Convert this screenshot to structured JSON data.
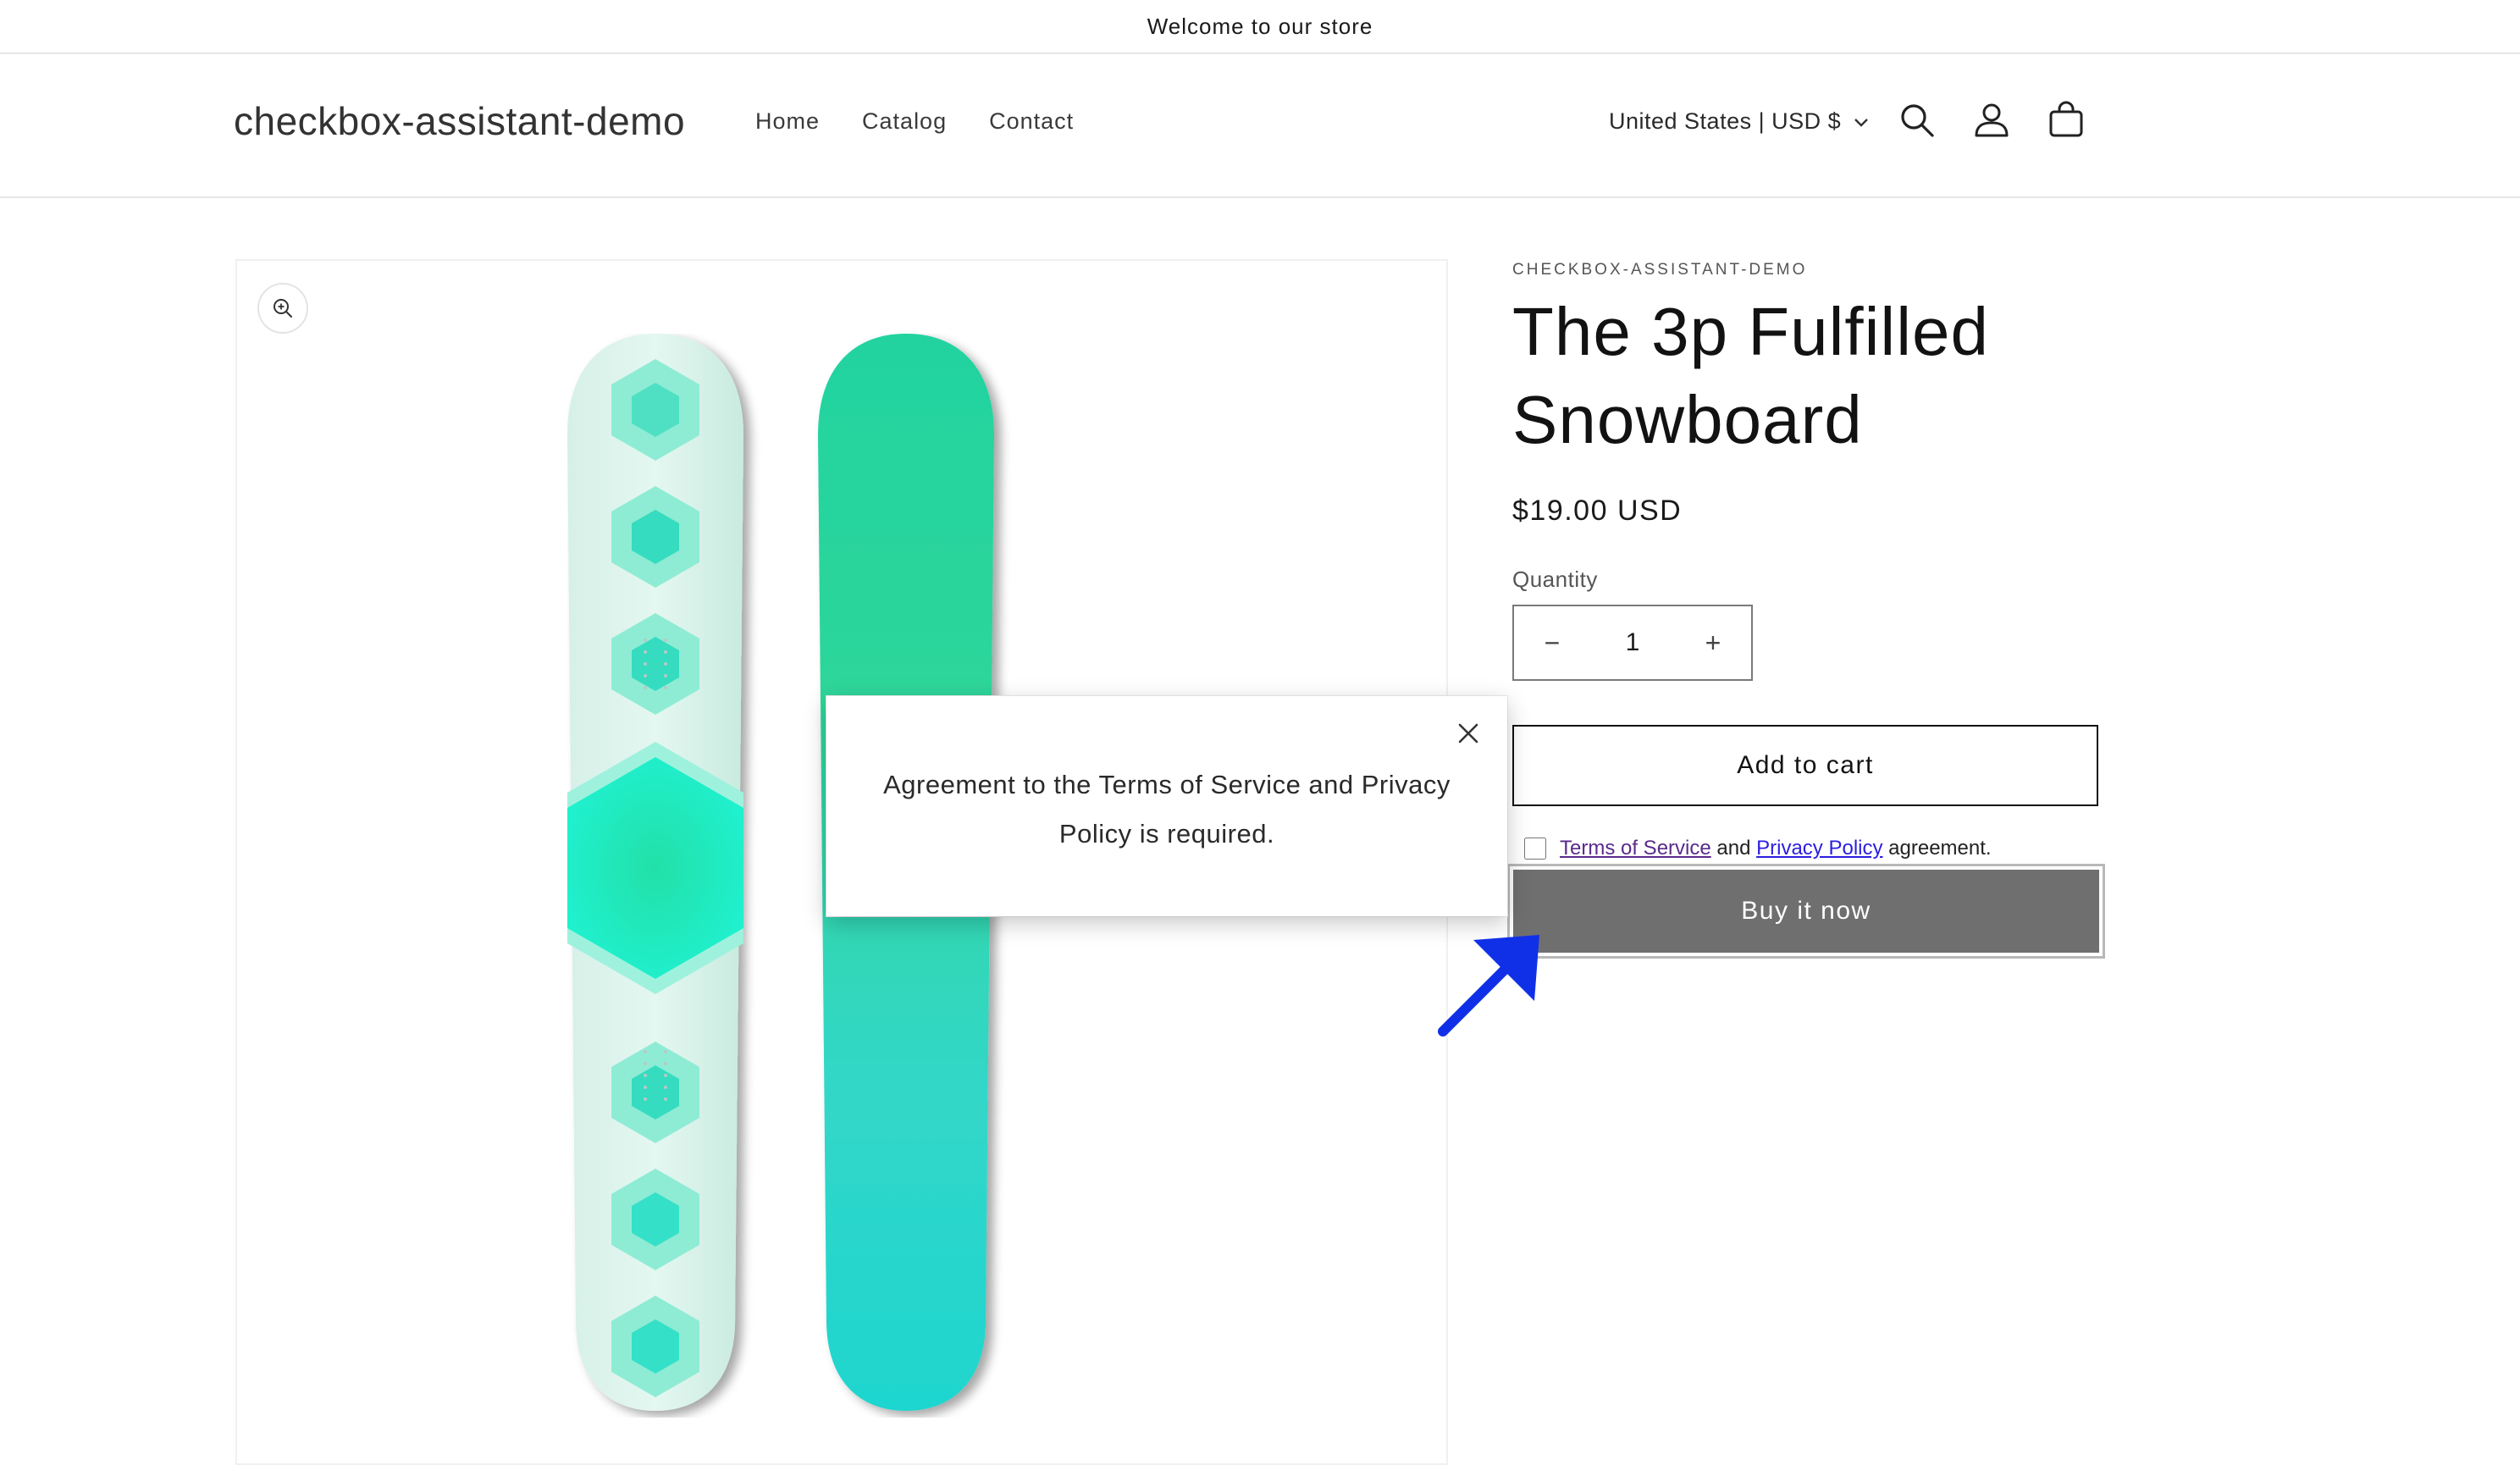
{
  "announcement": {
    "text": "Welcome to our store"
  },
  "header": {
    "logo": "checkbox-assistant-demo",
    "nav": [
      "Home",
      "Catalog",
      "Contact"
    ],
    "locale": "United States | USD $",
    "icons": [
      "search-icon",
      "account-icon",
      "cart-icon",
      "chevron-down-icon"
    ]
  },
  "product": {
    "vendor": "CHECKBOX-ASSISTANT-DEMO",
    "title_line1": "The 3p Fulfilled",
    "title_line2": "Snowboard",
    "price": "$19.00 USD",
    "quantity_label": "Quantity",
    "quantity_value": "1",
    "decrease_symbol": "−",
    "increase_symbol": "+",
    "add_to_cart": "Add to cart",
    "buy_now": "Buy it now",
    "agreement": {
      "terms": "Terms of Service",
      "and": "and",
      "privacy": "Privacy Policy",
      "suffix": "agreement."
    }
  },
  "popup": {
    "message": "Agreement to the Terms of Service and Privacy Policy is required."
  },
  "colors": {
    "buy_button": "#6f6f6f",
    "annotation_arrow": "#1030e8",
    "link": "#2b1ee0",
    "board_accent": "#1fe0c0"
  }
}
